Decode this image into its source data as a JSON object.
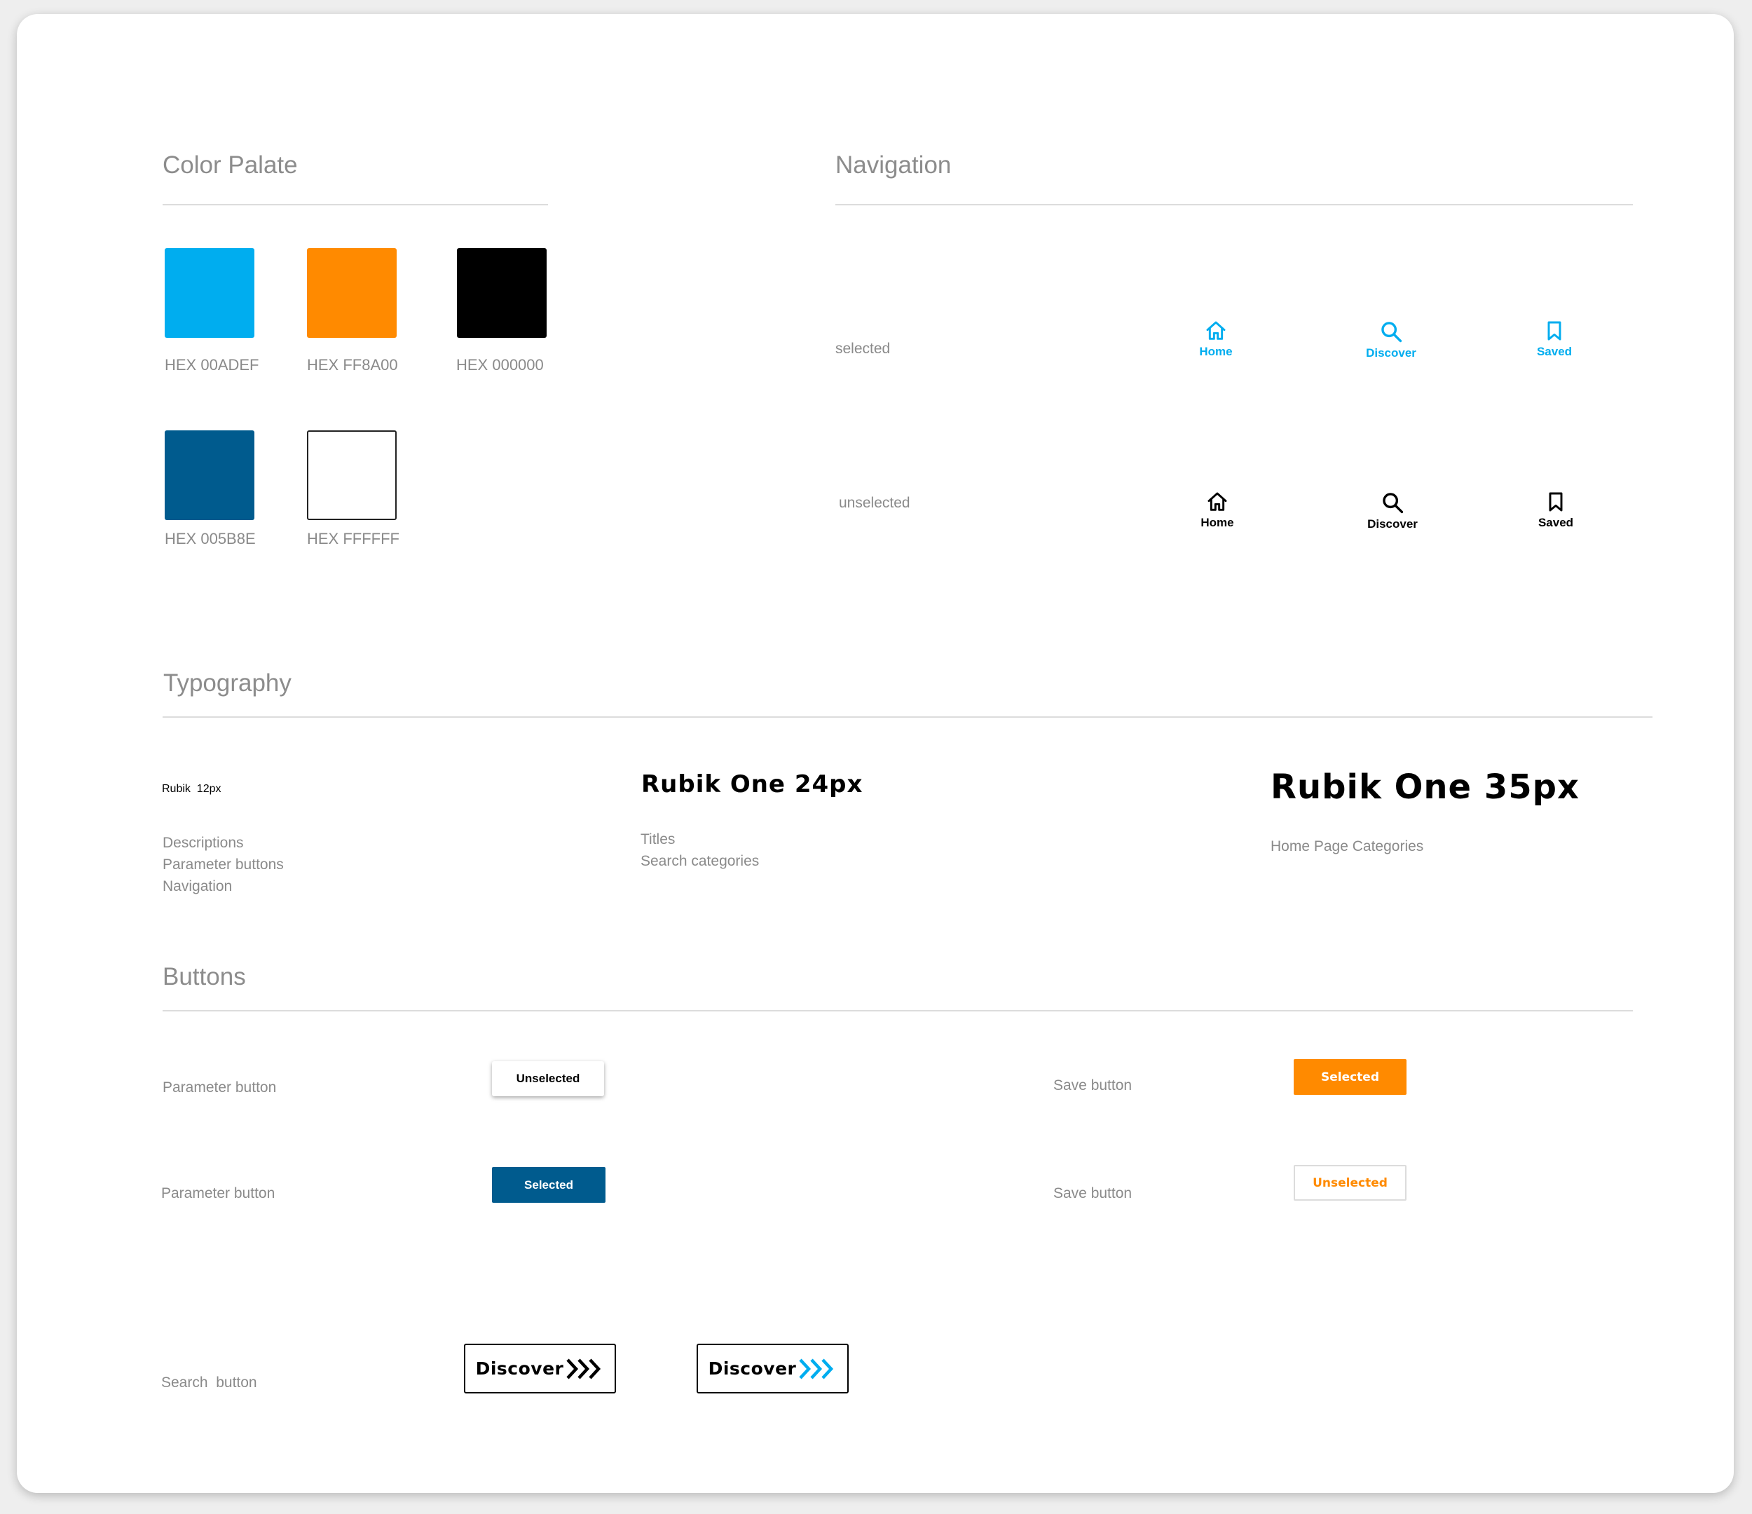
{
  "sections": {
    "color": "Color Palate",
    "navigation": "Navigation",
    "typography": "Typography",
    "buttons": "Buttons"
  },
  "palette": [
    {
      "hex": "HEX 00ADEF",
      "color": "#00ADEF"
    },
    {
      "hex": "HEX FF8A00",
      "color": "#FF8A00"
    },
    {
      "hex": "HEX 000000",
      "color": "#000000"
    },
    {
      "hex": "HEX 005B8E",
      "color": "#005B8E"
    },
    {
      "hex": "HEX FFFFFF",
      "color": "#FFFFFF"
    }
  ],
  "nav": {
    "selected_label": "selected",
    "unselected_label": "unselected",
    "items": [
      {
        "label": "Home",
        "icon": "home-icon"
      },
      {
        "label": "Discover",
        "icon": "search-icon"
      },
      {
        "label": "Saved",
        "icon": "bookmark-icon"
      }
    ],
    "selected_color": "#00ADEF",
    "unselected_color": "#000000"
  },
  "typography": {
    "small": {
      "title": "Rubik  12px",
      "uses": [
        "Descriptions",
        "Parameter buttons",
        "Navigation"
      ]
    },
    "medium": {
      "title": "Rubik One 24px",
      "uses": [
        "Titles",
        "Search categories"
      ]
    },
    "large": {
      "title": "Rubik One 35px",
      "uses": [
        "Home Page Categories"
      ]
    }
  },
  "buttons": {
    "param_unselected": {
      "label": "Parameter button",
      "button": "Unselected"
    },
    "param_selected": {
      "label": "Parameter button",
      "button": "Selected"
    },
    "save_selected": {
      "label": "Save button",
      "button": "Selected"
    },
    "save_unselected": {
      "label": "Save button",
      "button": "Unselected"
    },
    "search": {
      "label": "Search  button",
      "button_1": "Discover",
      "button_2": "Discover"
    }
  }
}
